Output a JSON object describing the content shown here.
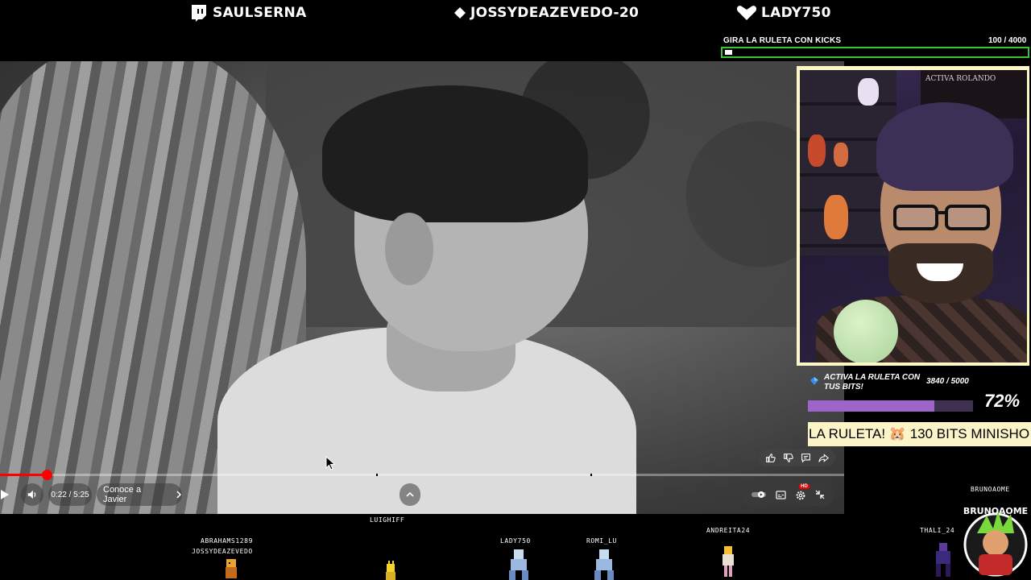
{
  "top_subs": [
    {
      "name": "SAULSERNA",
      "icon": "twitch-icon"
    },
    {
      "name": "JOSSYDEAZEVEDO-20",
      "icon": "diamond-icon"
    },
    {
      "name": "LADY750",
      "icon": "heart-icon"
    }
  ],
  "kicks_goal": {
    "label": "GIRA LA RULETA CON KICKS",
    "count": "100  / 4000",
    "progress_fraction": 0.025,
    "bar_border_color": "#37c53a"
  },
  "player": {
    "time": "0:22 / 5:25",
    "chapter": "Conoce a Javier",
    "progress_fraction": 0.055,
    "progress_color": "#ff0000",
    "icons": {
      "play": "play-icon",
      "volume": "volume-icon",
      "chapter_next": "chevron-right-icon",
      "expand": "chevron-up-icon",
      "like": "thumbs-up-icon",
      "dislike": "thumbs-down-icon",
      "comment": "comment-icon",
      "share": "share-icon",
      "autoplay": "autoplay-toggle-icon",
      "subtitles": "subtitles-icon",
      "settings": "gear-icon",
      "fullscreen_exit": "exit-fullscreen-icon"
    },
    "hd_badge": "HD"
  },
  "webcam": {
    "sign_text": "ACTIVA ROLANDO"
  },
  "bits_goal": {
    "label": "ACTIVA LA RULETA CON TUS BITS!",
    "count": "3840 / 5000",
    "percent": "72%",
    "progress_fraction": 0.768,
    "fill_color": "#9d64c9",
    "ticker": "LA RULETA! 🐹 130 BITS MINISHO"
  },
  "viewers": [
    {
      "name": "ABRAHAMS1289"
    },
    {
      "name": "JOSSYDEAZEVEDO"
    },
    {
      "name": "LUIGHIFF"
    },
    {
      "name": "LADY750"
    },
    {
      "name": "ROMI_LU"
    },
    {
      "name": "ANDREITA24"
    },
    {
      "name": "THALI_24"
    },
    {
      "name": "BRUNOAOME"
    }
  ],
  "badge_text": "BRUNOAOME"
}
